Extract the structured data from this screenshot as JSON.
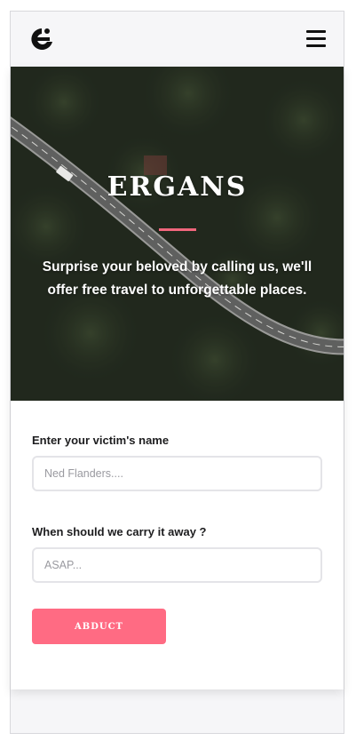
{
  "header": {
    "logo_icon": "ergans-e-logo-icon",
    "menu_icon": "hamburger-menu-icon"
  },
  "hero": {
    "title": "ERGANS",
    "tagline": "Surprise your beloved by calling us, we'll offer free travel to unforgettable places.",
    "accent_color": "#f0667c"
  },
  "form": {
    "name_label": "Enter your victim's name",
    "name_placeholder": "Ned Flanders....",
    "when_label": "When should we carry it away ?",
    "when_placeholder": "ASAP...",
    "submit_label": "ABDUCT",
    "submit_color": "#ff6b83"
  }
}
